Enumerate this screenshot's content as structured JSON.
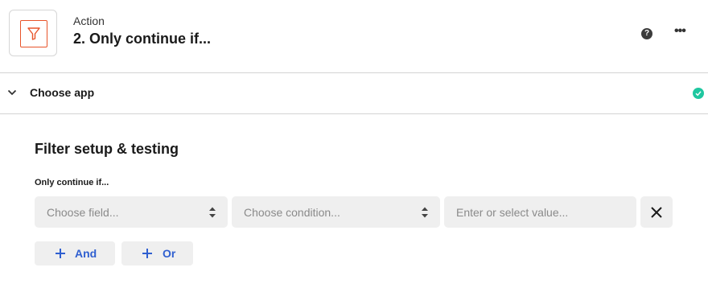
{
  "header": {
    "icon": "filter-icon",
    "step_kind": "Action",
    "step_title": "2. Only continue if...",
    "help_icon": "help-icon",
    "help_glyph": "?",
    "more_icon": "more-icon",
    "more_glyph": "•••"
  },
  "section": {
    "chevron_icon": "chevron-down-icon",
    "label": "Choose app",
    "status_icon": "check-circle-icon",
    "status_color": "#1fc7a0"
  },
  "filter": {
    "title": "Filter setup & testing",
    "rule_label": "Only continue if...",
    "field_placeholder": "Choose field...",
    "condition_placeholder": "Choose condition...",
    "value_placeholder": "Enter or select value...",
    "and_label": "And",
    "or_label": "Or"
  },
  "colors": {
    "accent": "#e8542a",
    "link": "#2f5fd0",
    "control_bg": "#efefef"
  }
}
